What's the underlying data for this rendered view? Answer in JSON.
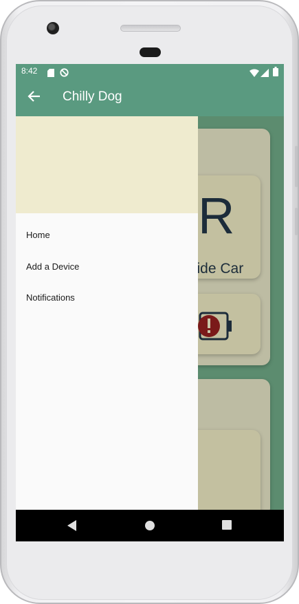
{
  "status_bar": {
    "time": "8:42",
    "left_icons": [
      "sd-card-icon",
      "do-not-disturb-icon"
    ],
    "right_icons": [
      "wifi-icon",
      "signal-icon",
      "battery-icon"
    ]
  },
  "app_bar": {
    "title": "Chilly Dog",
    "back_icon": "back-arrow-icon"
  },
  "background_content": {
    "big_letter": "R",
    "partial_text": "side Car",
    "alert_icon": "battery-alert-icon"
  },
  "drawer": {
    "items": [
      {
        "label": "Home"
      },
      {
        "label": "Add a Device"
      },
      {
        "label": "Notifications"
      }
    ]
  },
  "nav_bar": {
    "buttons": [
      "back-triangle-icon",
      "home-circle-icon",
      "recents-square-icon"
    ]
  },
  "colors": {
    "app_bar": "#5a9a80",
    "drawer_header": "#efebcf",
    "drawer_bg": "#fafafa",
    "nav_bar": "#000000"
  }
}
